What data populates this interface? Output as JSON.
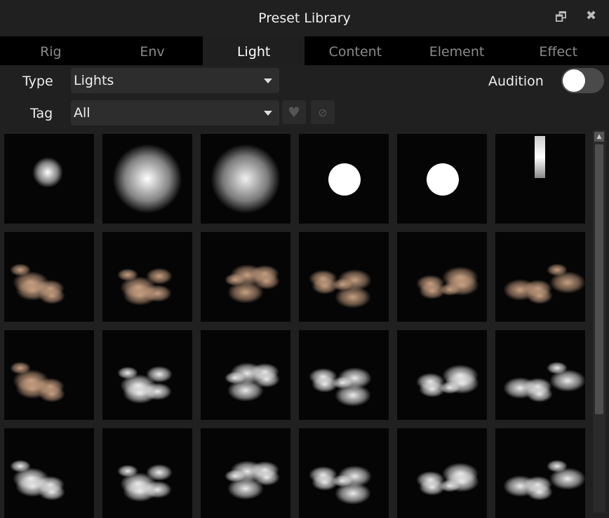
{
  "window": {
    "title": "Preset Library",
    "restore_icon": "restore-window-icon",
    "close_icon": "close-icon"
  },
  "tabs": [
    {
      "label": "Rig"
    },
    {
      "label": "Env"
    },
    {
      "label": "Light",
      "active": true
    },
    {
      "label": "Content"
    },
    {
      "label": "Element"
    },
    {
      "label": "Effect"
    }
  ],
  "filters": {
    "type_label": "Type",
    "type_value": "Lights",
    "tag_label": "Tag",
    "tag_value": "All",
    "favorite_icon": "heart-icon",
    "hidden_icon": "eye-slash-icon"
  },
  "audition": {
    "label": "Audition",
    "on": false
  },
  "thumbnails": [
    "small-sphere-light",
    "ring-sphere-light",
    "soft-sphere-light",
    "sphere-face-light",
    "sphere-face-light-dim",
    "tube-light",
    "warm-cloud",
    "dark-cloud",
    "warm-cloud-soft",
    "scattered-cloud",
    "warm-patchy-cloud",
    "warm-dark-cloud",
    "warm-cloud-left",
    "white-cumulus",
    "white-wispy-cloud",
    "white-cloud-bank",
    "white-cloud-row",
    "white-cloud-small",
    "white-cloud-low",
    "white-cloud-drift",
    "white-cumulus-large",
    "white-cloud-cluster",
    "white-cloud-strip",
    "white-cloud-puffs"
  ]
}
